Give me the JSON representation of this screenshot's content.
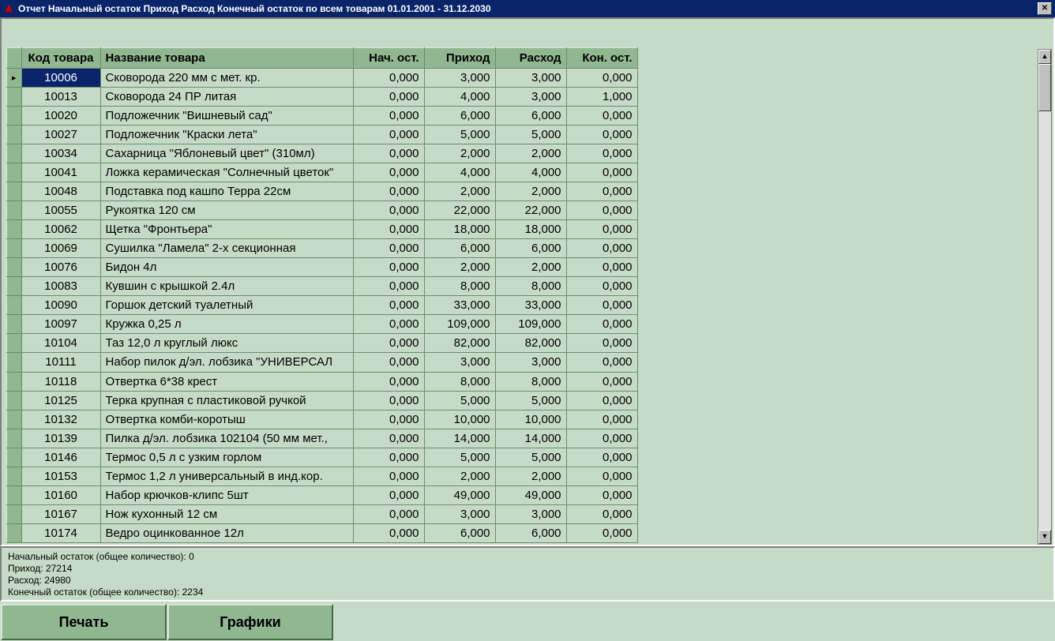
{
  "title": "Отчет Начальный остаток Приход Расход Конечный остаток по всем товарам   01.01.2001 - 31.12.2030",
  "columns": {
    "handle": "",
    "code": "Код товара",
    "name": "Название товара",
    "start": "Нач. ост.",
    "in": "Приход",
    "out": "Расход",
    "end": "Кон. ост."
  },
  "rows": [
    {
      "code": "10006",
      "name": "Сковорода 220 мм с мет. кр.",
      "start": "0,000",
      "in": "3,000",
      "out": "3,000",
      "end": "0,000",
      "selected": true
    },
    {
      "code": "10013",
      "name": "Сковорода 24 ПР литая",
      "start": "0,000",
      "in": "4,000",
      "out": "3,000",
      "end": "1,000"
    },
    {
      "code": "10020",
      "name": "Подложечник \"Вишневый сад\"",
      "start": "0,000",
      "in": "6,000",
      "out": "6,000",
      "end": "0,000"
    },
    {
      "code": "10027",
      "name": "Подложечник \"Краски лета\"",
      "start": "0,000",
      "in": "5,000",
      "out": "5,000",
      "end": "0,000"
    },
    {
      "code": "10034",
      "name": "Сахарница \"Яблоневый цвет\" (310мл)",
      "start": "0,000",
      "in": "2,000",
      "out": "2,000",
      "end": "0,000"
    },
    {
      "code": "10041",
      "name": "Ложка керамическая \"Солнечный цветок\"",
      "start": "0,000",
      "in": "4,000",
      "out": "4,000",
      "end": "0,000"
    },
    {
      "code": "10048",
      "name": "Подставка под кашпо Терра 22см",
      "start": "0,000",
      "in": "2,000",
      "out": "2,000",
      "end": "0,000"
    },
    {
      "code": "10055",
      "name": "Рукоятка 120 см",
      "start": "0,000",
      "in": "22,000",
      "out": "22,000",
      "end": "0,000"
    },
    {
      "code": "10062",
      "name": "Щетка \"Фронтьера\"",
      "start": "0,000",
      "in": "18,000",
      "out": "18,000",
      "end": "0,000"
    },
    {
      "code": "10069",
      "name": "Сушилка \"Ламела\" 2-х секционная",
      "start": "0,000",
      "in": "6,000",
      "out": "6,000",
      "end": "0,000"
    },
    {
      "code": "10076",
      "name": "Бидон 4л",
      "start": "0,000",
      "in": "2,000",
      "out": "2,000",
      "end": "0,000"
    },
    {
      "code": "10083",
      "name": "Кувшин с крышкой 2.4л",
      "start": "0,000",
      "in": "8,000",
      "out": "8,000",
      "end": "0,000"
    },
    {
      "code": "10090",
      "name": "Горшок детский туалетный",
      "start": "0,000",
      "in": "33,000",
      "out": "33,000",
      "end": "0,000"
    },
    {
      "code": "10097",
      "name": "Кружка 0,25 л",
      "start": "0,000",
      "in": "109,000",
      "out": "109,000",
      "end": "0,000"
    },
    {
      "code": "10104",
      "name": "Таз 12,0 л круглый люкс",
      "start": "0,000",
      "in": "82,000",
      "out": "82,000",
      "end": "0,000"
    },
    {
      "code": "10111",
      "name": "Набор пилок д/эл. лобзика \"УНИВЕРСАЛ",
      "start": "0,000",
      "in": "3,000",
      "out": "3,000",
      "end": "0,000"
    },
    {
      "code": "10118",
      "name": "Отвертка 6*38 крест",
      "start": "0,000",
      "in": "8,000",
      "out": "8,000",
      "end": "0,000"
    },
    {
      "code": "10125",
      "name": "Терка крупная с пластиковой ручкой",
      "start": "0,000",
      "in": "5,000",
      "out": "5,000",
      "end": "0,000"
    },
    {
      "code": "10132",
      "name": "Отвертка комби-коротыш",
      "start": "0,000",
      "in": "10,000",
      "out": "10,000",
      "end": "0,000"
    },
    {
      "code": "10139",
      "name": "Пилка д/эл. лобзика 102104 (50 мм мет.,",
      "start": "0,000",
      "in": "14,000",
      "out": "14,000",
      "end": "0,000"
    },
    {
      "code": "10146",
      "name": "Термос 0,5 л с узким горлом",
      "start": "0,000",
      "in": "5,000",
      "out": "5,000",
      "end": "0,000"
    },
    {
      "code": "10153",
      "name": "Термос 1,2 л универсальный в инд.кор.",
      "start": "0,000",
      "in": "2,000",
      "out": "2,000",
      "end": "0,000"
    },
    {
      "code": "10160",
      "name": "Набор крючков-клипс 5шт",
      "start": "0,000",
      "in": "49,000",
      "out": "49,000",
      "end": "0,000"
    },
    {
      "code": "10167",
      "name": "Нож кухонный 12 см",
      "start": "0,000",
      "in": "3,000",
      "out": "3,000",
      "end": "0,000"
    },
    {
      "code": "10174",
      "name": "Ведро оцинкованное 12л",
      "start": "0,000",
      "in": "6,000",
      "out": "6,000",
      "end": "0,000"
    }
  ],
  "summary": {
    "line1": "Начальный остаток (общее количество): 0",
    "line2": "Приход: 27214",
    "line3": "Расход: 24980",
    "line4": "Конечный остаток (общее количество): 2234"
  },
  "buttons": {
    "print": "Печать",
    "charts": "Графики"
  },
  "marker": "▸"
}
